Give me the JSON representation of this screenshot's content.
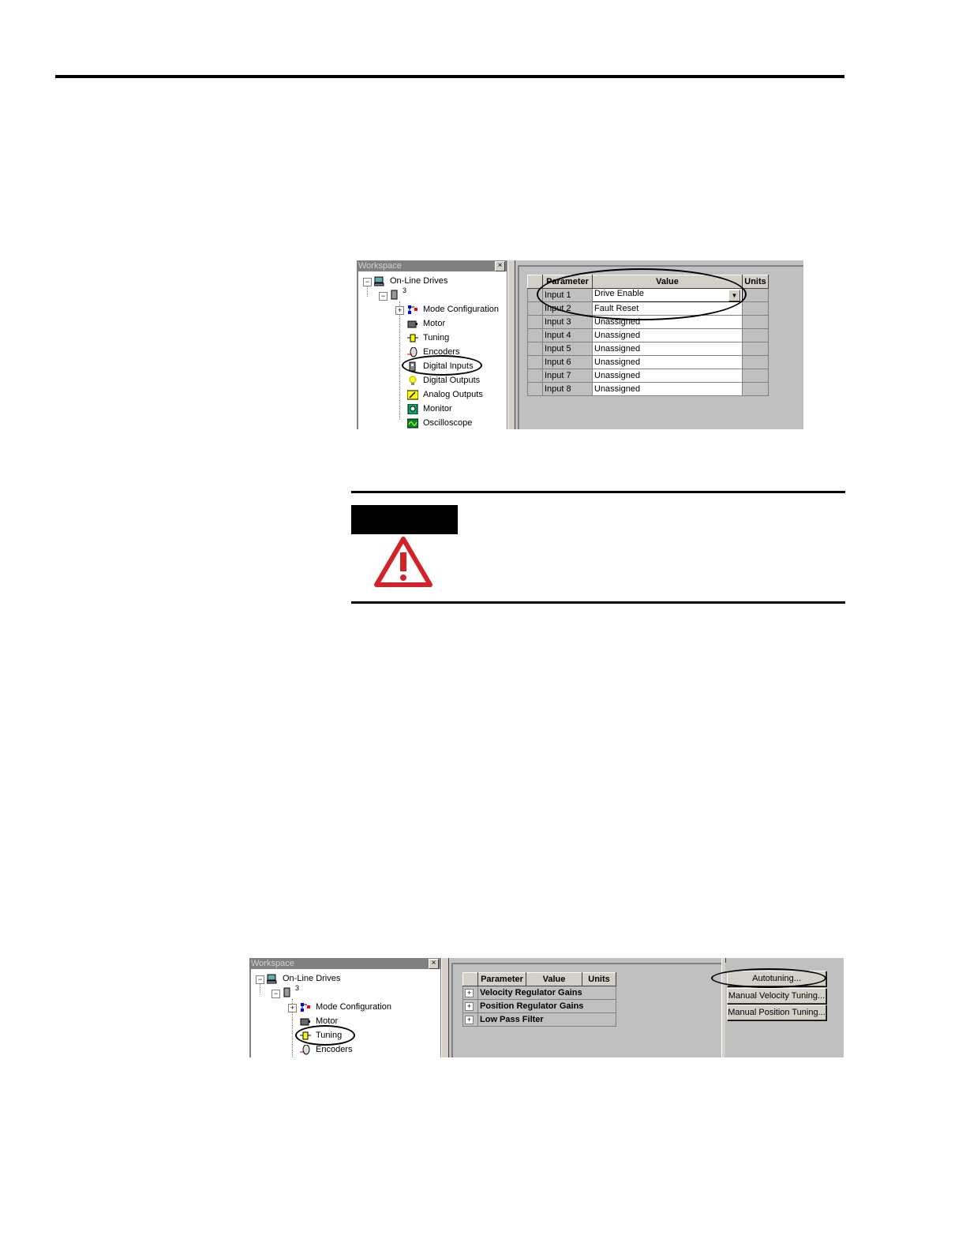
{
  "figure1": {
    "workspace": {
      "title": "Workspace",
      "close": "×",
      "tree": {
        "root": "On-Line Drives",
        "drive": "3\nk",
        "items": [
          {
            "label": "Mode Configuration",
            "icon": "mode-config-icon"
          },
          {
            "label": "Motor",
            "icon": "motor-icon"
          },
          {
            "label": "Tuning",
            "icon": "tuning-icon"
          },
          {
            "label": "Encoders",
            "icon": "encoder-icon"
          },
          {
            "label": "Digital Inputs",
            "icon": "digital-inputs-icon"
          },
          {
            "label": "Digital Outputs",
            "icon": "digital-outputs-icon"
          },
          {
            "label": "Analog Outputs",
            "icon": "analog-outputs-icon"
          },
          {
            "label": "Monitor",
            "icon": "monitor-icon"
          },
          {
            "label": "Oscilloscope",
            "icon": "oscilloscope-icon"
          }
        ]
      }
    },
    "table": {
      "headers": [
        "Parameter",
        "Value",
        "Units"
      ],
      "rows": [
        {
          "param": "Input 1",
          "value": "Drive Enable"
        },
        {
          "param": "Input 2",
          "value": "Fault Reset"
        },
        {
          "param": "Input 3",
          "value": "Unassigned"
        },
        {
          "param": "Input 4",
          "value": "Unassigned"
        },
        {
          "param": "Input 5",
          "value": "Unassigned"
        },
        {
          "param": "Input 6",
          "value": "Unassigned"
        },
        {
          "param": "Input 7",
          "value": "Unassigned"
        },
        {
          "param": "Input 8",
          "value": "Unassigned"
        }
      ]
    }
  },
  "figure2": {
    "workspace": {
      "title": "Workspace",
      "close": "×",
      "tree": {
        "root": "On-Line Drives",
        "drive": "3\nk",
        "items": [
          {
            "label": "Mode Configuration",
            "icon": "mode-config-icon"
          },
          {
            "label": "Motor",
            "icon": "motor-icon"
          },
          {
            "label": "Tuning",
            "icon": "tuning-icon"
          },
          {
            "label": "Encoders",
            "icon": "encoder-icon"
          }
        ]
      }
    },
    "table": {
      "headers": [
        "Parameter",
        "Value",
        "Units"
      ],
      "groups": [
        "Velocity Regulator Gains",
        "Position Regulator Gains",
        "Low Pass Filter"
      ]
    },
    "buttons": {
      "autotuning": "Autotuning...",
      "manual_velocity": "Manual Velocity Tuning...",
      "manual_position": "Manual Position Tuning..."
    }
  },
  "warning": {
    "icon": "warning-triangle-icon",
    "color": "#d2232a"
  }
}
